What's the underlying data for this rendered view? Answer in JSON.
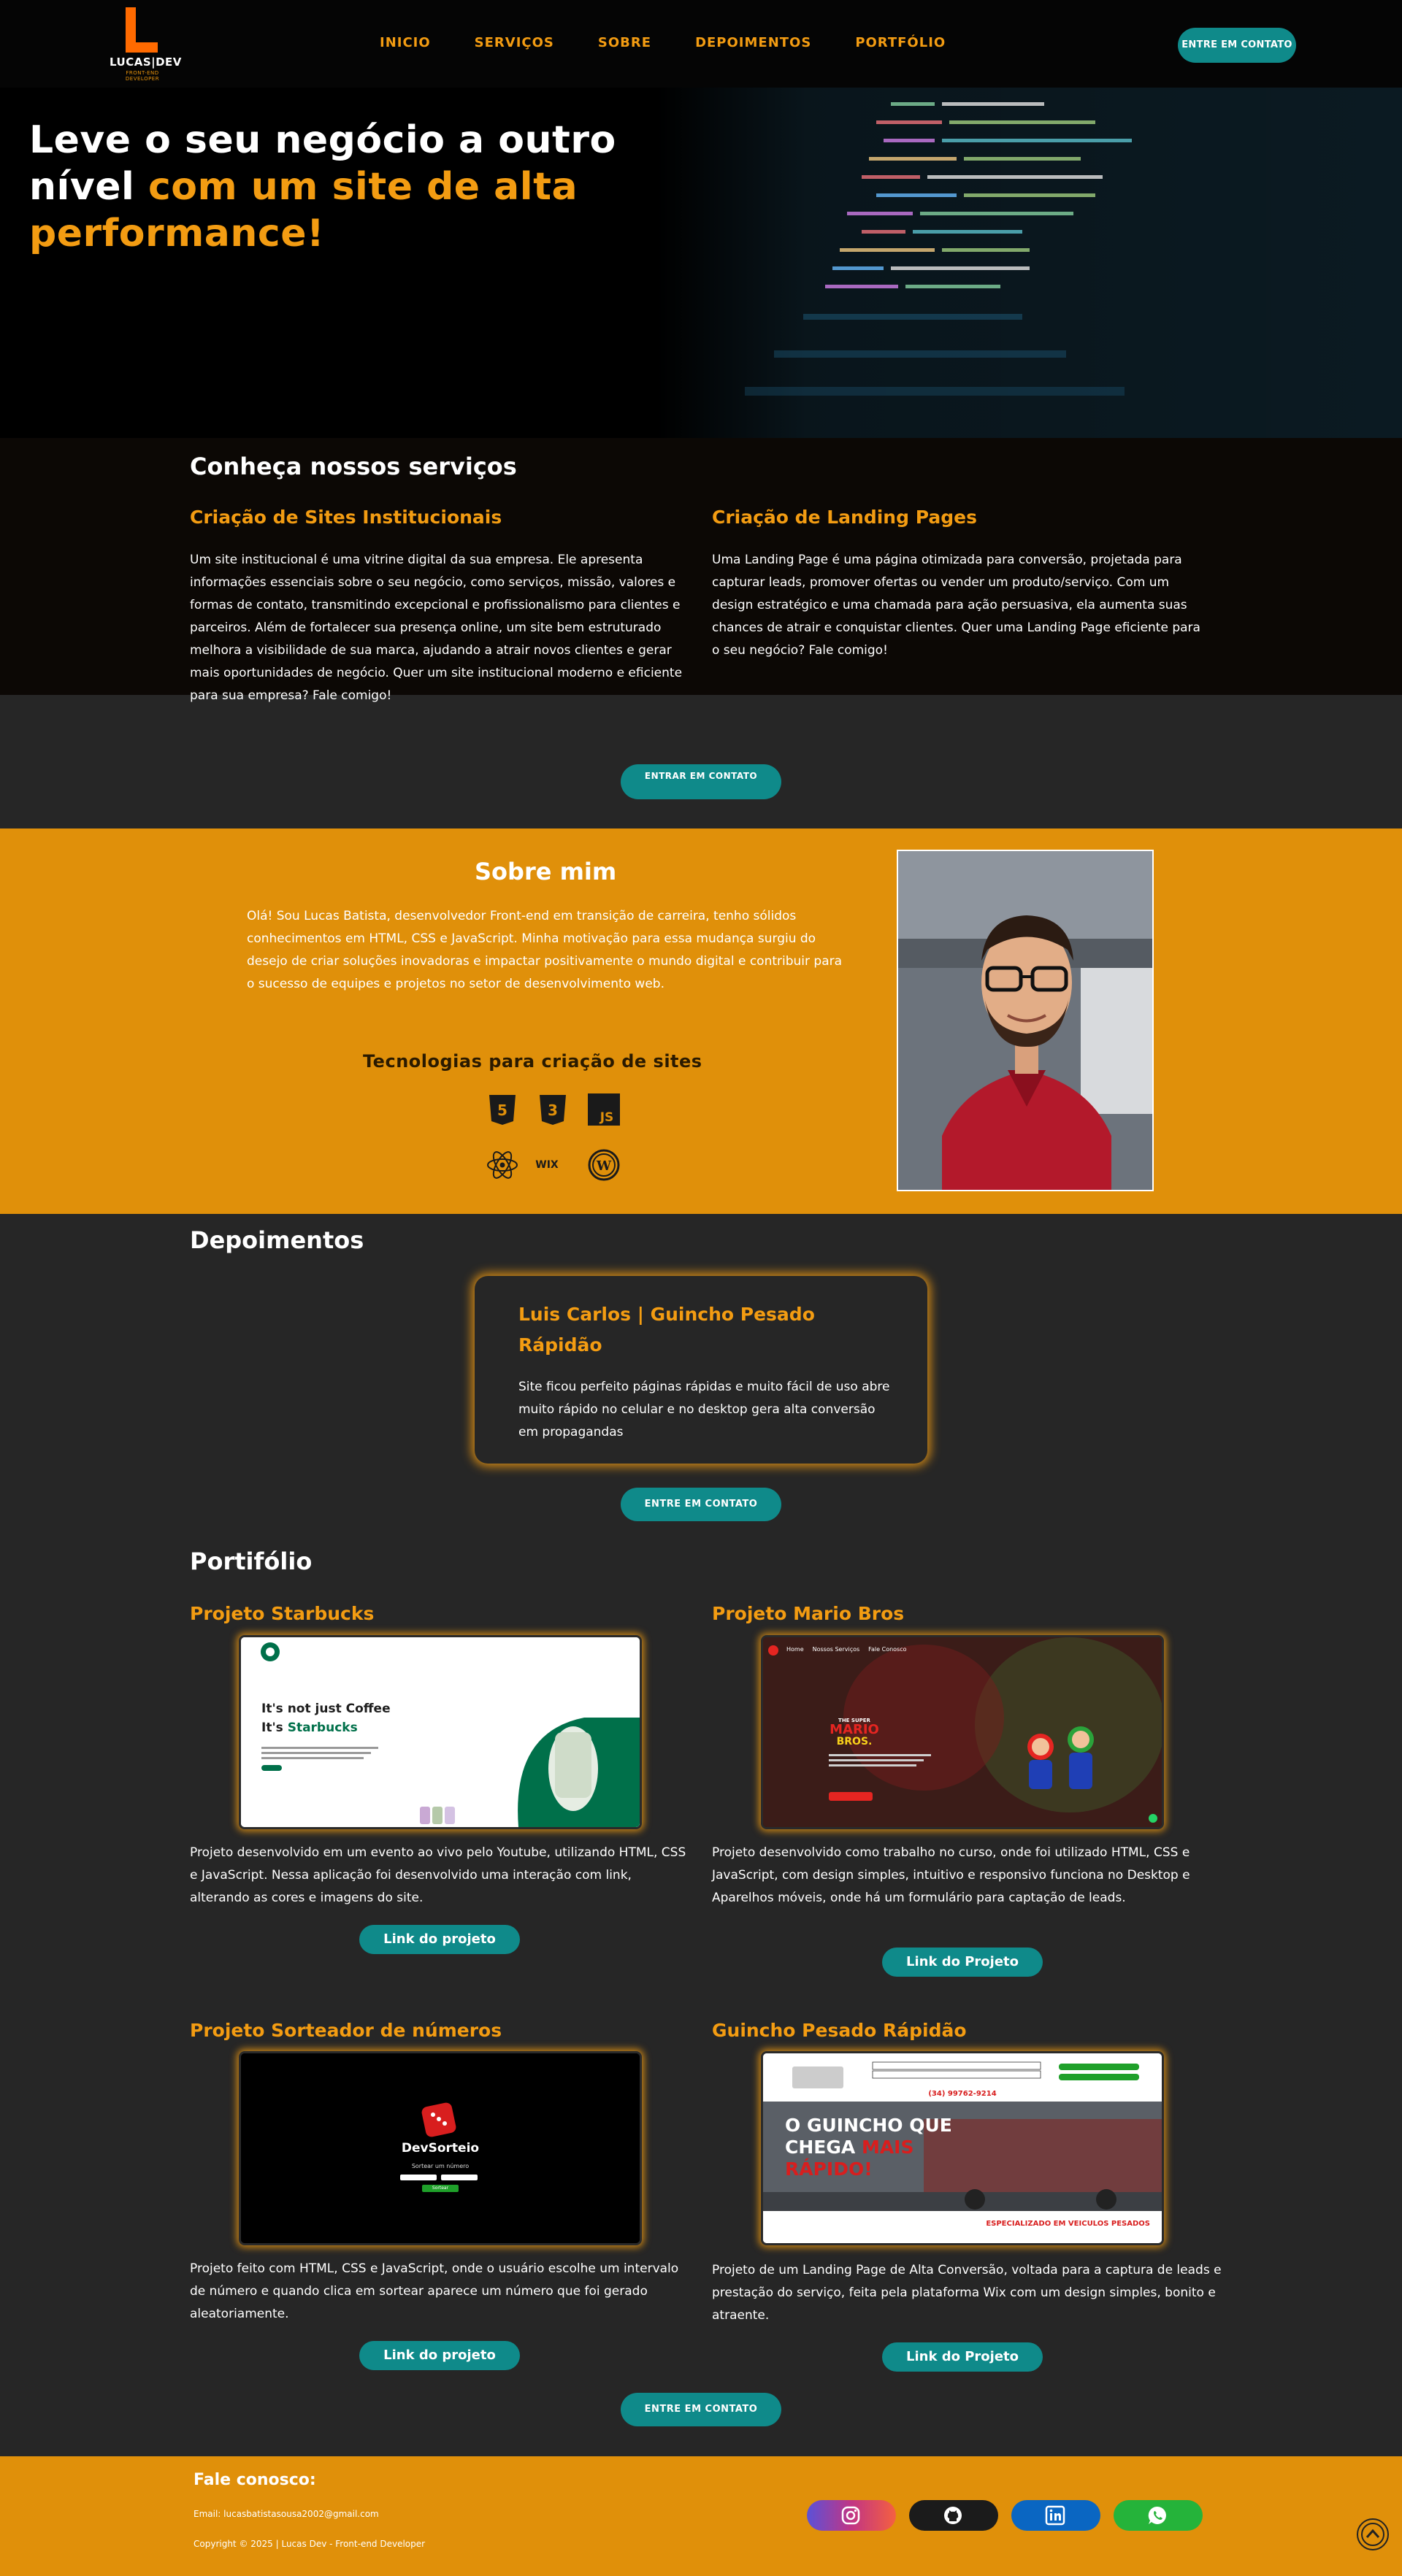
{
  "header": {
    "logo_name": "LUCAS|DEV",
    "logo_sub": "FRONT-END DEVELOPER",
    "nav": [
      "INICIO",
      "SERVIÇOS",
      "SOBRE",
      "DEPOIMENTOS",
      "PORTFÓLIO"
    ],
    "cta": "ENTRE EM CONTATO"
  },
  "hero": {
    "title_white": "Leve o seu negócio a outro nível ",
    "title_highlight": "com um site de alta performance!"
  },
  "services": {
    "title": "Conheça nossos serviços",
    "items": [
      {
        "title": "Criação de Sites Institucionais",
        "text": "Um site institucional é uma vitrine digital da sua empresa. Ele apresenta informações essenciais sobre o seu negócio, como serviços, missão, valores e formas de contato, transmitindo excepcional e profissionalismo para clientes e parceiros. Além de fortalecer sua presença online, um site bem estruturado melhora a visibilidade de sua marca, ajudando a atrair novos clientes e gerar mais oportunidades de negócio. Quer um site institucional moderno e eficiente para sua empresa? Fale comigo!"
      },
      {
        "title": "Criação de Landing Pages",
        "text": "Uma Landing Page é uma página otimizada para conversão, projetada para capturar leads, promover ofertas ou vender um produto/serviço. Com um design estratégico e uma chamada para ação persuasiva, ela aumenta suas chances de atrair e conquistar clientes. Quer uma Landing Page eficiente para o seu negócio? Fale comigo!"
      }
    ],
    "cta": "ENTRAR EM CONTATO"
  },
  "about": {
    "title": "Sobre mim",
    "text": "Olá! Sou Lucas Batista, desenvolvedor Front-end em transição de carreira, tenho sólidos conhecimentos em HTML, CSS e JavaScript. Minha motivação para essa mudança surgiu do desejo de criar soluções inovadoras e impactar positivamente o mundo digital e contribuir para o sucesso de equipes e projetos no setor de desenvolvimento web.",
    "tech_title": "Tecnologias para criação de sites",
    "tech_icons": [
      "html5-icon",
      "css3-icon",
      "javascript-icon",
      "react-icon",
      "wix-icon",
      "wordpress-icon"
    ],
    "wix_label": "WIX"
  },
  "testimonials": {
    "title": "Depoimentos",
    "name": "Luis Carlos | Guincho Pesado Rápidão",
    "text": "Site ficou perfeito páginas rápidas e muito fácil de uso abre muito rápido no celular e no desktop gera alta conversão em propagandas",
    "cta": "ENTRE EM CONTATO"
  },
  "portfolio": {
    "title": "Portifólio",
    "projects": [
      {
        "title": "Projeto Starbucks",
        "text": "Projeto desenvolvido em um evento ao vivo pelo Youtube, utilizando HTML, CSS e JavaScript. Nessa aplicação foi desenvolvido uma interação com link, alterando as cores e imagens do site.",
        "link": "Link do projeto",
        "shot": {
          "h1": "It's not just Coffee",
          "h2": "It's",
          "brand": "Starbucks"
        }
      },
      {
        "title": "Projeto Mario Bros",
        "text": "Projeto desenvolvido como trabalho no curso, onde foi utilizado HTML, CSS e JavaScript, com design simples, intuitivo e responsivo funciona no Desktop e Aparelhos móveis, onde há um formulário para captação de leads.",
        "link": "Link do Projeto",
        "shot": {
          "nav": [
            "Home",
            "Nossos Serviços",
            "Fale Conosco"
          ],
          "logo_top": "THE SUPER",
          "logo_main": "MARIO",
          "logo_bottom": "BROS."
        }
      },
      {
        "title": "Projeto Sorteador de números",
        "text": "Projeto feito com HTML, CSS e JavaScript, onde o usuário escolhe um intervalo de número e quando clica em sortear aparece um número que foi gerado aleatoriamente.",
        "link": "Link do projeto",
        "shot": {
          "app": "DevSorteio",
          "label": "Sortear um número",
          "button": "Sortear"
        }
      },
      {
        "title": "Guincho Pesado Rápidão",
        "text": "Projeto de um Landing Page de Alta Conversão, voltada para a captura de leads e prestação do serviço, feita pela plataforma Wix com um design simples, bonito e atraente.",
        "link": "Link do Projeto",
        "shot": {
          "phone": "(34) 99762-9214",
          "headline_1": "O GUINCHO QUE",
          "headline_2": "CHEGA",
          "headline_3": "MAIS",
          "headline_4": "RÁPIDO!",
          "footer": "ESPECIALIZADO EM VEICULOS PESADOS"
        }
      }
    ],
    "cta": "ENTRE EM CONTATO"
  },
  "footer": {
    "title": "Fale conosco:",
    "email": "Email: lucasbatistasousa2002@gmail.com",
    "copyright": "Copyright © 2025 | Lucas Dev - Front-end Developer",
    "socials": [
      {
        "name": "instagram-icon",
        "color": "#c13584"
      },
      {
        "name": "github-icon",
        "color": "#1b1b1b"
      },
      {
        "name": "linkedin-icon",
        "color": "#0a66c2"
      },
      {
        "name": "whatsapp-icon",
        "color": "#25d366"
      }
    ]
  },
  "colors": {
    "accent": "#f39c12",
    "teal": "#0f8a8a",
    "orange_bg": "#e0900a",
    "dark_bg": "#262626"
  }
}
